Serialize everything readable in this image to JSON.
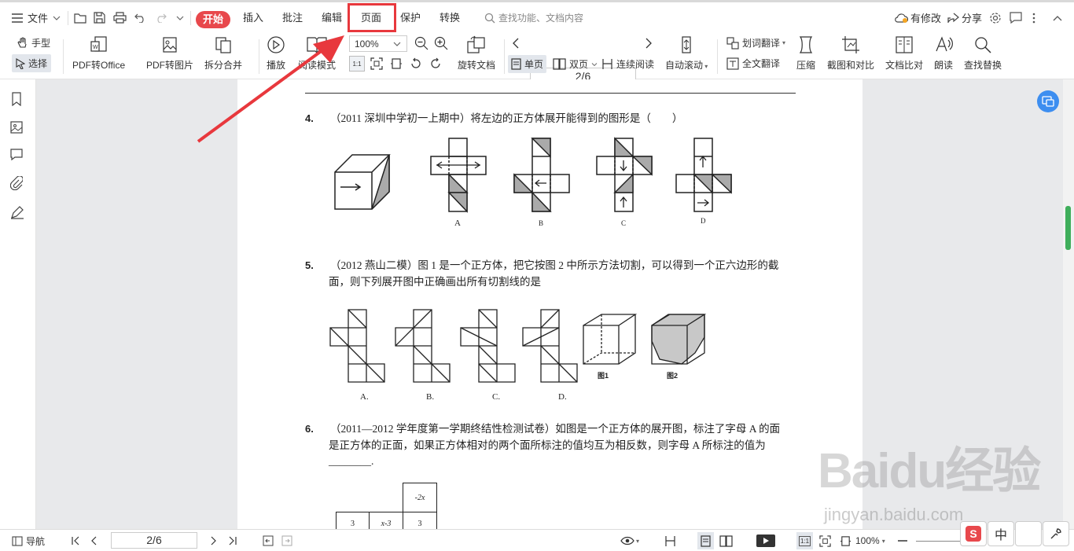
{
  "topbar": {
    "file_menu": "文件",
    "tabs": [
      "开始",
      "插入",
      "批注",
      "编辑",
      "页面",
      "保护",
      "转换"
    ],
    "search_placeholder": "查找功能、文档内容",
    "modified": "有修改",
    "share": "分享"
  },
  "ribbon": {
    "hand": "手型",
    "select": "选择",
    "pdf_to_office": "PDF转Office",
    "pdf_to_image": "PDF转图片",
    "split_merge": "拆分合并",
    "play": "播放",
    "read_mode": "阅读模式",
    "zoom": "100%",
    "rotate_doc": "旋转文档",
    "page_input": "2/6",
    "single_page": "单页",
    "double_page": "双页",
    "continuous": "连续阅读",
    "auto_scroll": "自动滚动",
    "word_translate": "划词翻译",
    "full_translate": "全文翻译",
    "compress": "压缩",
    "screenshot_compare": "截图和对比",
    "doc_compare": "文档比对",
    "read_aloud": "朗读",
    "find_replace": "查找替换"
  },
  "document": {
    "q4_num": "4.",
    "q4_text": "（2011 深圳中学初一上期中）将左边的正方体展开能得到的图形是（　　）",
    "q4_options": [
      "A",
      "B",
      "C",
      "D"
    ],
    "q5_num": "5.",
    "q5_line1": "（2012 燕山二模）图 1 是一个正方体，把它按图 2 中所示方法切割，可以得到一个正六边形的截",
    "q5_line2": "面，则下列展开图中正确画出所有切割线的是",
    "q5_options": [
      "A.",
      "B.",
      "C.",
      "D."
    ],
    "fig1": "图1",
    "fig2": "图2",
    "q6_num": "6.",
    "q6_line1": "（2011—2012 学年度第一学期终结性检测试卷）如图是一个正方体的展开图，标注了字母 A 的面",
    "q6_line2": "是正方体的正面，如果正方体相对的两个面所标注的值均互为相反数，则字母 A 所标注的值为",
    "q6_blank": "________.",
    "q6_cell_top": "-2x",
    "q6_cells": [
      "3",
      "x-3",
      "3"
    ]
  },
  "bottombar": {
    "nav": "导航",
    "page": "2/6",
    "zoom": "100%"
  },
  "watermark": {
    "brand": "Baidu经验",
    "url": "jingyan.baidu.com"
  },
  "ime": {
    "lang": "中"
  },
  "colors": {
    "accent_red": "#e8484c",
    "highlight_box": "#e8383d",
    "scroll_thumb": "#3fae5b"
  }
}
